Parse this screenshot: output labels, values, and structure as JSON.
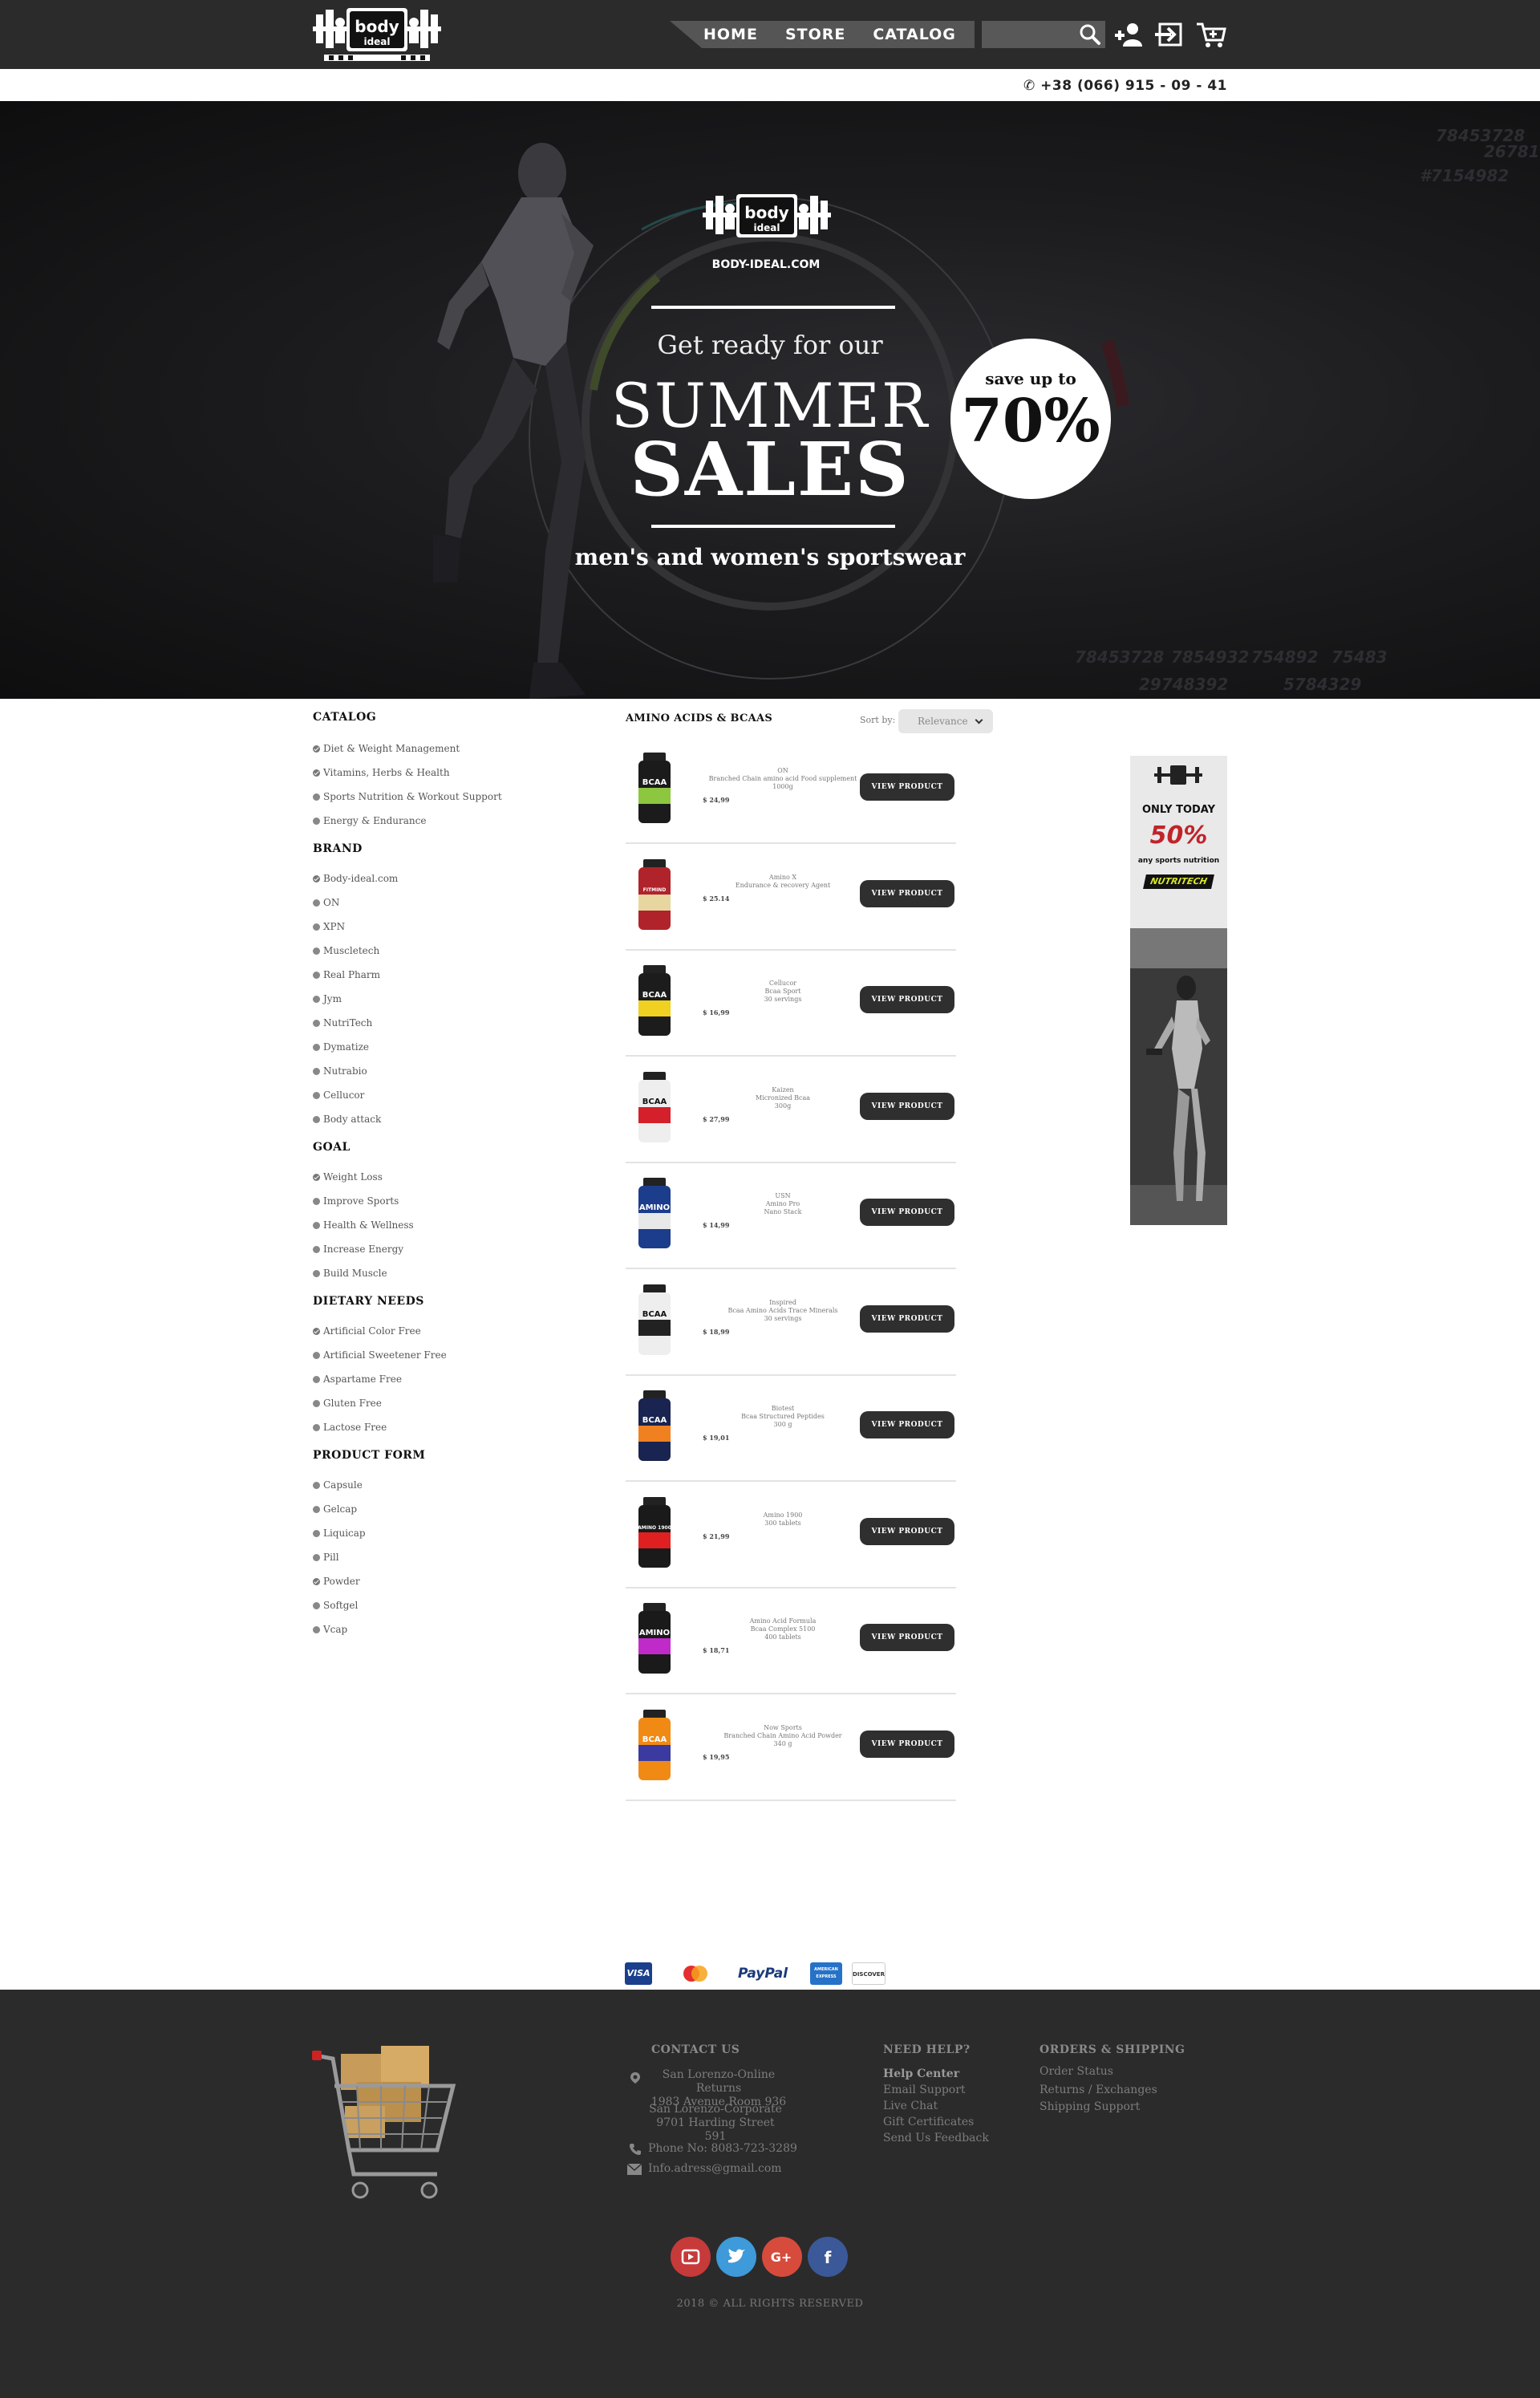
{
  "header": {
    "logo": {
      "word1": "body",
      "word2": "ideal"
    },
    "nav": [
      {
        "label": "HOME"
      },
      {
        "label": "STORE"
      },
      {
        "label": "CATALOG"
      }
    ],
    "search_placeholder": "",
    "icons": [
      "search-icon",
      "add-user-icon",
      "login-icon",
      "cart-icon"
    ],
    "phone": "+38 (066) 915 - 09 - 41"
  },
  "hero": {
    "site": "BODY-IDEAL.COM",
    "line1": "Get ready for our",
    "line2": "SUMMER",
    "line3": "SALES",
    "subtitle": "men's and women's sportswear",
    "badge_small": "save up to",
    "badge_big": "70%",
    "bg_numbers": [
      "78453728",
      "7854932",
      "754892",
      "75483",
      "29748392",
      "5784329",
      "78453728",
      "26781",
      "#7154982"
    ]
  },
  "sidebar": {
    "sections": [
      {
        "title": "CATALOG",
        "items": [
          "Diet & Weight Management",
          "Vitamins, Herbs & Health",
          "Sports Nutrition & Workout Support",
          "Energy & Endurance"
        ]
      },
      {
        "title": "BRAND",
        "items": [
          "Body-ideal.com",
          "ON",
          "XPN",
          "Muscletech",
          "Real Pharm",
          "Jym",
          "NutriTech",
          "Dymatize",
          "Nutrabio",
          "Cellucor",
          "Body attack"
        ]
      },
      {
        "title": "GOAL",
        "items": [
          "Weight Loss",
          "Improve Sports",
          "Health & Wellness",
          "Increase Energy",
          "Build Muscle"
        ]
      },
      {
        "title": "DIETARY NEEDS",
        "items": [
          "Artificial Color Free",
          "Artificial Sweetener Free",
          "Aspartame Free",
          "Gluten Free",
          "Lactose Free"
        ]
      },
      {
        "title": "PRODUCT FORM",
        "items": [
          "Capsule",
          "Gelcap",
          "Liquicap",
          "Pill",
          "Powder",
          "Softgel",
          "Vcap"
        ]
      }
    ]
  },
  "catalog": {
    "title": "AMINO ACIDS & BCAAS",
    "sort_label": "Sort by:",
    "sort_value": "Relevance",
    "button_label": "VIEW PRODUCT",
    "products": [
      {
        "lines": [
          "ON",
          "Branched Chain amino acid Food supplement",
          "1000g"
        ],
        "price": "$ 24,99",
        "color": "#1b1b1b",
        "accent": "#8dc63f",
        "label": "BCAA"
      },
      {
        "lines": [
          "Amino X",
          "Endurance & recovery Agent"
        ],
        "price": "$ 25.14",
        "color": "#b0232b",
        "accent": "#e8d6a0",
        "label": "FITMIND"
      },
      {
        "lines": [
          "Cellucor",
          "Bcaa Sport",
          "30 servings"
        ],
        "price": "$ 16,99",
        "color": "#1c1c1c",
        "accent": "#f0d020",
        "label": "BCAA"
      },
      {
        "lines": [
          "Kaizen",
          "Micronized Bcaa",
          "300g"
        ],
        "price": "$ 27,99",
        "color": "#eeeeee",
        "accent": "#d4202a",
        "label": "BCAA"
      },
      {
        "lines": [
          "USN",
          "Amino Pro",
          "Nano Stack"
        ],
        "price": "$ 14,99",
        "color": "#1c3c8c",
        "accent": "#e8e8e8",
        "label": "AMINO"
      },
      {
        "lines": [
          "Inspired",
          "Bcaa Amino Acids Trace Minerals",
          "30 servings"
        ],
        "price": "$ 18,99",
        "color": "#eeeeee",
        "accent": "#222222",
        "label": "BCAA"
      },
      {
        "lines": [
          "Biotest",
          "Bcaa Structured Peptides",
          "300 g"
        ],
        "price": "$ 19,01",
        "color": "#1a2450",
        "accent": "#f08020",
        "label": "BCAA"
      },
      {
        "lines": [
          "Amino 1900",
          "300 tablets"
        ],
        "price": "$ 21,99",
        "color": "#1a1a1a",
        "accent": "#e02020",
        "label": "AMINO 1900"
      },
      {
        "lines": [
          "Amino Acid Formula",
          "Bcaa Complex 5100",
          "400 tablets"
        ],
        "price": "$ 18,71",
        "color": "#1a1a1a",
        "accent": "#c02ac8",
        "label": "AMINO"
      },
      {
        "lines": [
          "Now Sports",
          "Branched Chain Amino Acid Powder",
          "340 g"
        ],
        "price": "$ 19,95",
        "color": "#f08a14",
        "accent": "#3a3aa0",
        "label": "BCAA"
      }
    ]
  },
  "ad": {
    "today": "ONLY TODAY",
    "discount": "50%",
    "subtitle": "any sports nutrition",
    "brand": "NUTRITECH"
  },
  "payments": [
    "VISA",
    "MasterCard",
    "PayPal",
    "AMERICAN EXPRESS",
    "DISCOVER"
  ],
  "footer": {
    "contact": {
      "title": "CONTACT US",
      "addr1": [
        "San Lorenzo-Online Returns",
        "1983 Avenue,Room 936"
      ],
      "addr2": [
        "San Lorenzo-Corporate",
        "9701 Harding Street 591"
      ],
      "phone": "Phone No: 8083-723-3289",
      "email": "Info.adress@gmail.com"
    },
    "help": {
      "title": "NEED HELP?",
      "items": [
        "Help Center",
        "Email Support",
        "Live Chat",
        "Gift Certificates",
        "Send Us Feedback"
      ]
    },
    "orders": {
      "title": "ORDERS & SHIPPING",
      "items": [
        "Order Status",
        "Returns / Exchanges",
        "Shipping Support"
      ]
    },
    "social": [
      {
        "name": "youtube",
        "color": "#c63a3a"
      },
      {
        "name": "twitter",
        "color": "#3e9ad9"
      },
      {
        "name": "google-plus",
        "color": "#d74b3c"
      },
      {
        "name": "facebook",
        "color": "#3b5998"
      }
    ],
    "copyright": "2018 ©    ALL RIGHTS RESERVED"
  }
}
